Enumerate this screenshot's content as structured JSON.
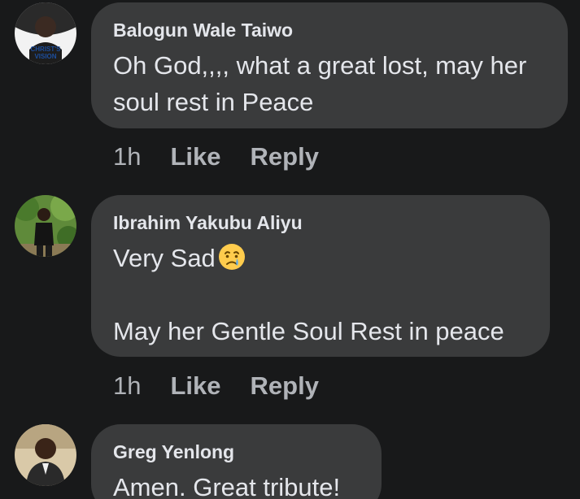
{
  "comments": [
    {
      "author": "Balogun Wale Taiwo",
      "lines": [
        "Oh God,,,, what a great lost, may her",
        "soul rest in Peace"
      ],
      "avatar_caption": [
        "CHRIST'S",
        "VISION"
      ],
      "time": "1h",
      "like_label": "Like",
      "reply_label": "Reply"
    },
    {
      "author": "Ibrahim Yakubu Aliyu",
      "lines": [
        "Very Sad",
        "",
        "May her Gentle Soul Rest in peace"
      ],
      "emoji": "crying-face-icon",
      "time": "1h",
      "like_label": "Like",
      "reply_label": "Reply"
    },
    {
      "author": "Greg Yenlong",
      "lines": [
        "Amen. Great tribute!"
      ]
    }
  ],
  "colors": {
    "background": "#18191a",
    "bubble": "#3a3b3c",
    "primary_text": "#e4e6eb",
    "secondary_text": "#b0b3b8"
  }
}
